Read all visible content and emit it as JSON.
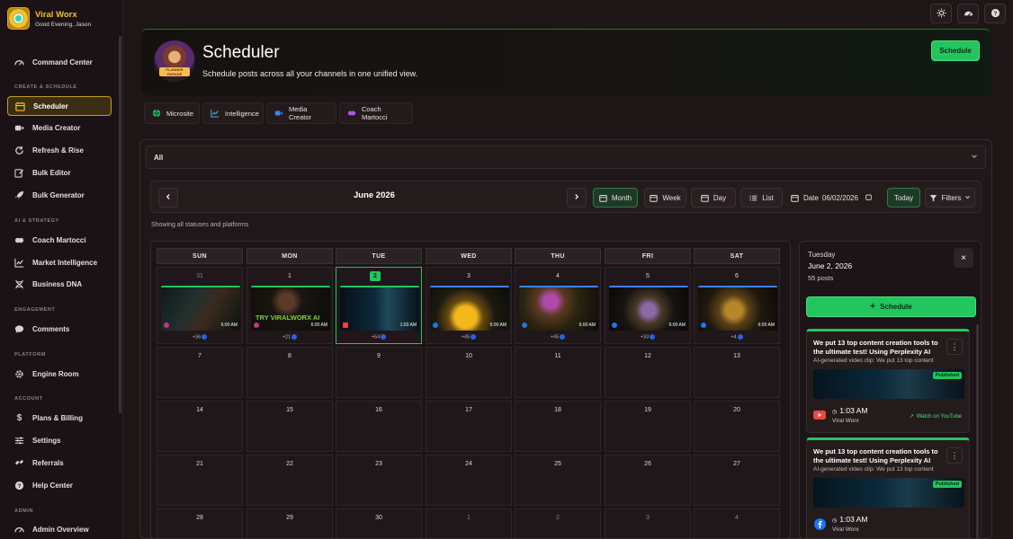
{
  "brand": {
    "name": "Viral Worx",
    "greeting": "Good Evening, Jason"
  },
  "sidebar": {
    "sections": [
      "CREATE & SCHEDULE",
      "AI & STRATEGY",
      "ENGAGEMENT",
      "PLATFORM",
      "ACCOUNT",
      "ADMIN"
    ],
    "items": [
      {
        "label": "Command Center",
        "icon": "gauge-icon"
      },
      {
        "label": "Scheduler",
        "icon": "calendar-icon",
        "active": true
      },
      {
        "label": "Media Creator",
        "icon": "video-icon"
      },
      {
        "label": "Refresh & Rise",
        "icon": "refresh-icon"
      },
      {
        "label": "Bulk Editor",
        "icon": "edit-icon"
      },
      {
        "label": "Bulk Generator",
        "icon": "rocket-icon"
      },
      {
        "label": "Coach Martocci",
        "icon": "brain-icon"
      },
      {
        "label": "Market Intelligence",
        "icon": "chart-icon"
      },
      {
        "label": "Business DNA",
        "icon": "dna-icon"
      },
      {
        "label": "Comments",
        "icon": "comment-icon"
      },
      {
        "label": "Engine Room",
        "icon": "gear-icon"
      },
      {
        "label": "Plans & Billing",
        "icon": "dollar-icon"
      },
      {
        "label": "Settings",
        "icon": "sliders-icon"
      },
      {
        "label": "Referrals",
        "icon": "referral-icon"
      },
      {
        "label": "Help Center",
        "icon": "help-icon"
      },
      {
        "label": "Admin Overview",
        "icon": "admin-icon"
      }
    ]
  },
  "header": {
    "title": "Scheduler",
    "subtitle": "Schedule posts across all your channels in one unified view.",
    "schedule_label": "Schedule",
    "illustration_text": "PLANNER PARADE"
  },
  "quick_links": [
    {
      "label": "Microsite",
      "icon": "globe-icon"
    },
    {
      "label": "Intelligence",
      "icon": "chart-icon"
    },
    {
      "label": "Media Creator",
      "icon": "video-icon"
    },
    {
      "label": "Coach Martocci",
      "icon": "brain-icon"
    }
  ],
  "filter": {
    "selected": "All"
  },
  "calendar": {
    "month_label": "June 2026",
    "views": [
      "Month",
      "Week",
      "Day",
      "List"
    ],
    "active_view": "Month",
    "date_label": "Date",
    "date_value": "06/02/2026",
    "today_label": "Today",
    "filters_label": "Filters",
    "status_line": "Showing all statuses and platforms",
    "weekdays": [
      "SUN",
      "MON",
      "TUE",
      "WED",
      "THU",
      "FRI",
      "SAT"
    ],
    "weeks": [
      [
        "31",
        "1",
        "2",
        "3",
        "4",
        "5",
        "6"
      ],
      [
        "7",
        "8",
        "9",
        "10",
        "11",
        "12",
        "13"
      ],
      [
        "14",
        "15",
        "16",
        "17",
        "18",
        "19",
        "20"
      ],
      [
        "21",
        "22",
        "23",
        "24",
        "25",
        "26",
        "27"
      ],
      [
        "28",
        "29",
        "30",
        "1",
        "2",
        "3",
        "4"
      ]
    ],
    "first_week_posts": [
      {
        "time": "6:00 AM",
        "more": "+36",
        "overlay": "",
        "bar": "#22c55e",
        "platform": "#c13584"
      },
      {
        "time": "6:00 AM",
        "more": "+21",
        "overlay": "TRY VIRALWORX AI",
        "bar": "#22c55e",
        "platform": "#c13584"
      },
      {
        "time": "1:03 AM",
        "more": "+54",
        "overlay": "",
        "bar": "#22c55e",
        "platform": "#ef4444"
      },
      {
        "time": "6:00 AM",
        "more": "+45",
        "overlay": "",
        "bar": "#3b82f6",
        "platform": "#1877f2"
      },
      {
        "time": "6:00 AM",
        "more": "+45",
        "overlay": "",
        "bar": "#3b82f6",
        "platform": "#1877f2"
      },
      {
        "time": "6:00 AM",
        "more": "+33",
        "overlay": "",
        "bar": "#3b82f6",
        "platform": "#1877f2"
      },
      {
        "time": "6:00 AM",
        "more": "+4",
        "overlay": "",
        "bar": "#3b82f6",
        "platform": "#1877f2"
      }
    ]
  },
  "day_panel": {
    "weekday": "Tuesday",
    "date": "June 2, 2026",
    "count": "55 posts",
    "schedule_label": "Schedule",
    "posts": [
      {
        "title": "We put 13 top content creation tools to the ultimate test! Using Perplexity AI",
        "desc": "AI-generated video clip: We put 13 top content",
        "status": "Published",
        "time": "1:03 AM",
        "account": "Viral Worx",
        "platform": "youtube-icon",
        "watch": "Watch on YouTube"
      },
      {
        "title": "We put 13 top content creation tools to the ultimate test! Using Perplexity AI",
        "desc": "AI-generated video clip: We put 13 top content",
        "status": "Published",
        "time": "1:03 AM",
        "account": "Viral Worx",
        "platform": "facebook-icon",
        "watch": ""
      }
    ]
  },
  "colors": {
    "accent": "#22c55e",
    "active_nav": "#c99a1e",
    "brand": "#f2c12e"
  }
}
